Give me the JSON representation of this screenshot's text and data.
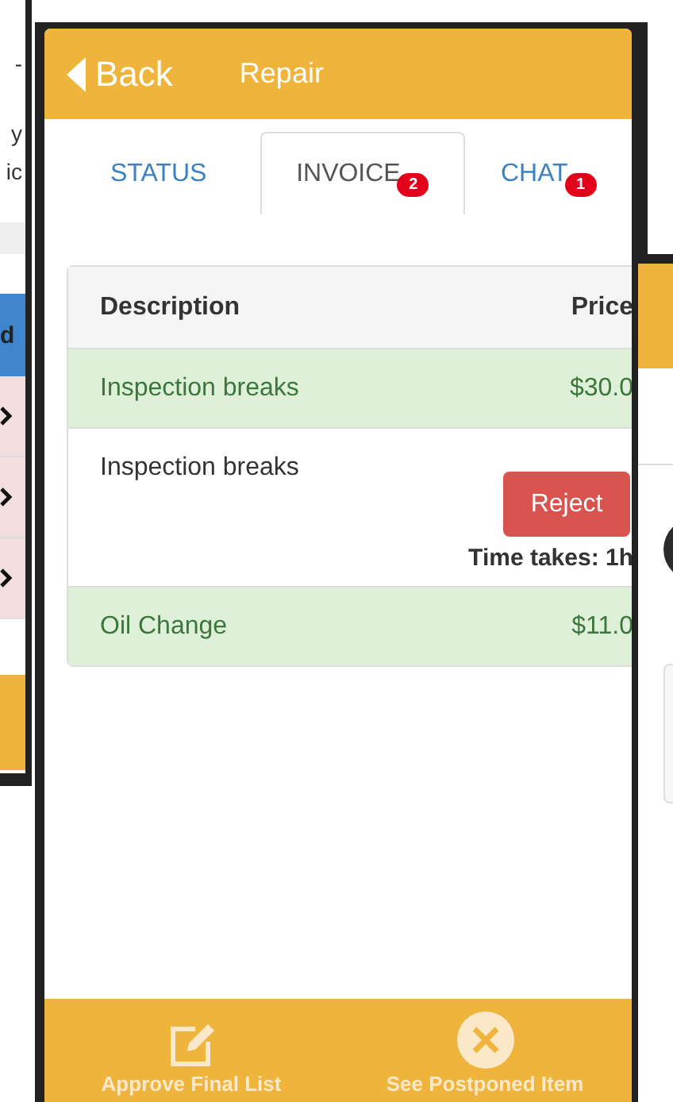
{
  "left_screen": {
    "texts": [
      "-",
      "y",
      "ic"
    ],
    "table_header": "d",
    "rows": [
      {
        "kind": "link"
      },
      {
        "kind": "link"
      },
      {
        "kind": "link"
      }
    ]
  },
  "header": {
    "back": "Back",
    "title": "Repair"
  },
  "tabs": [
    {
      "label": "STATUS",
      "selected": false
    },
    {
      "label": "INVOICE",
      "selected": true,
      "badge": "2"
    },
    {
      "label": "CHAT",
      "selected": false,
      "badge": "1"
    }
  ],
  "table": {
    "columns": [
      "Description",
      "Price"
    ],
    "rows": [
      {
        "description": "Inspection breaks",
        "price": "$30.0",
        "approved": true
      },
      {
        "description": "Inspection breaks",
        "approved": false,
        "action": "Reject",
        "time": "Time takes: 1h"
      },
      {
        "description": "Oil Change",
        "price": "$11.0",
        "approved": true
      }
    ]
  },
  "footer": [
    {
      "label": "Approve Final List",
      "kind": "approve"
    },
    {
      "label": "See Postponed Item",
      "kind": "postponed"
    }
  ]
}
